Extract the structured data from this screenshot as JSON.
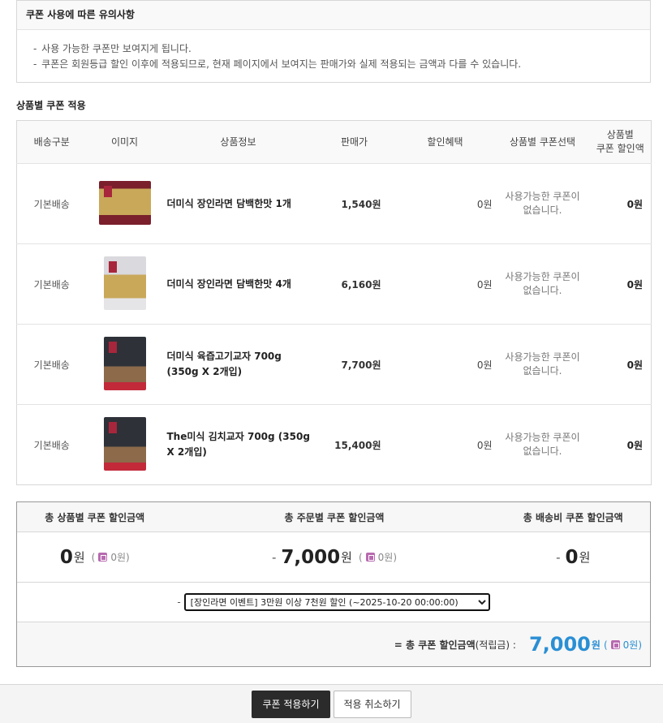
{
  "notice": {
    "title": "쿠폰 사용에 따른 유의사항",
    "items": [
      "사용 가능한 쿠폰만 보여지게 됩니다.",
      "쿠폰은 회원등급 할인 이후에 적용되므로, 현재 페이지에서 보여지는 판매가와 실제 적용되는 금액과 다를 수 있습니다."
    ]
  },
  "section_title": "상품별 쿠폰 적용",
  "table": {
    "headers": {
      "ship": "배송구분",
      "image": "이미지",
      "info": "상품정보",
      "price": "판매가",
      "benefit": "할인혜택",
      "coupon_select": "상품별 쿠폰선택",
      "coupon_discount_1": "상품별",
      "coupon_discount_2": "쿠폰 할인액"
    },
    "rows": [
      {
        "ship": "기본배송",
        "name": "더미식 장인라면 담백한맛 1개",
        "price": "1,540원",
        "benefit": "0원",
        "coupon_1": "사용가능한 쿠폰이",
        "coupon_2": "없습니다.",
        "discount": "0원"
      },
      {
        "ship": "기본배송",
        "name": "더미식 장인라면 담백한맛 4개",
        "price": "6,160원",
        "benefit": "0원",
        "coupon_1": "사용가능한 쿠폰이",
        "coupon_2": "없습니다.",
        "discount": "0원"
      },
      {
        "ship": "기본배송",
        "name": "더미식 육즙고기교자 700g (350g X 2개입)",
        "price": "7,700원",
        "benefit": "0원",
        "coupon_1": "사용가능한 쿠폰이",
        "coupon_2": "없습니다.",
        "discount": "0원"
      },
      {
        "ship": "기본배송",
        "name": "The미식 김치교자 700g (350g X 2개입)",
        "price": "15,400원",
        "benefit": "0원",
        "coupon_1": "사용가능한 쿠폰이",
        "coupon_2": "없습니다.",
        "discount": "0원"
      }
    ]
  },
  "summary": {
    "headers": {
      "product": "총 상품별 쿠폰 할인금액",
      "order": "총 주문별 쿠폰 할인금액",
      "shipping": "총 배송비 쿠폰 할인금액"
    },
    "product": {
      "value": "0",
      "unit": "원",
      "sub": "0원"
    },
    "order": {
      "minus": "-",
      "value": "7,000",
      "unit": "원",
      "sub": "0원"
    },
    "shipping": {
      "minus": "-",
      "value": "0",
      "unit": "원"
    },
    "select_dash": "-",
    "selected_coupon": "[장인라면 이벤트] 3만원 이상 7천원 할인 (~2025-10-20 00:00:00)",
    "total_label": "= 총 쿠폰 할인금액",
    "total_paren": "(적립금) :",
    "total_value": "7,000",
    "total_unit": "원",
    "total_sub": "0원"
  },
  "buttons": {
    "apply": "쿠폰 적용하기",
    "cancel": "적용 취소하기"
  },
  "icons": {
    "mileage": "mileage-icon",
    "mileage_color": "#b86ab0"
  },
  "colors": {
    "accent_blue": "#2a8fd4",
    "dark_button": "#2b2b2b"
  }
}
